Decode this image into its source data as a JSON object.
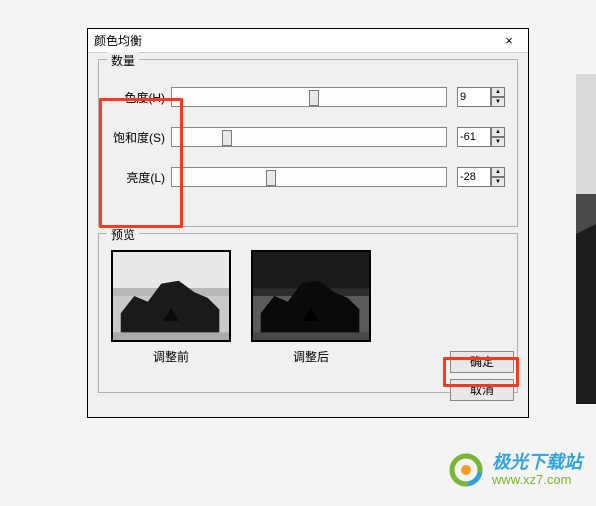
{
  "dialog": {
    "title": "颜色均衡",
    "close_icon": "×",
    "group_quantity": "数量",
    "group_preview": "预览",
    "sliders": [
      {
        "label": "色度(H)",
        "value": "9",
        "thumb_pct": 52
      },
      {
        "label": "饱和度(S)",
        "value": "-61",
        "thumb_pct": 20
      },
      {
        "label": "亮度(L)",
        "value": "-28",
        "thumb_pct": 36
      }
    ],
    "preview": {
      "before": "调整前",
      "after": "调整后"
    },
    "buttons": {
      "ok": "确定",
      "cancel": "取消"
    }
  },
  "brand": {
    "cn": "极光下载站",
    "url": "www.xz7.com"
  }
}
